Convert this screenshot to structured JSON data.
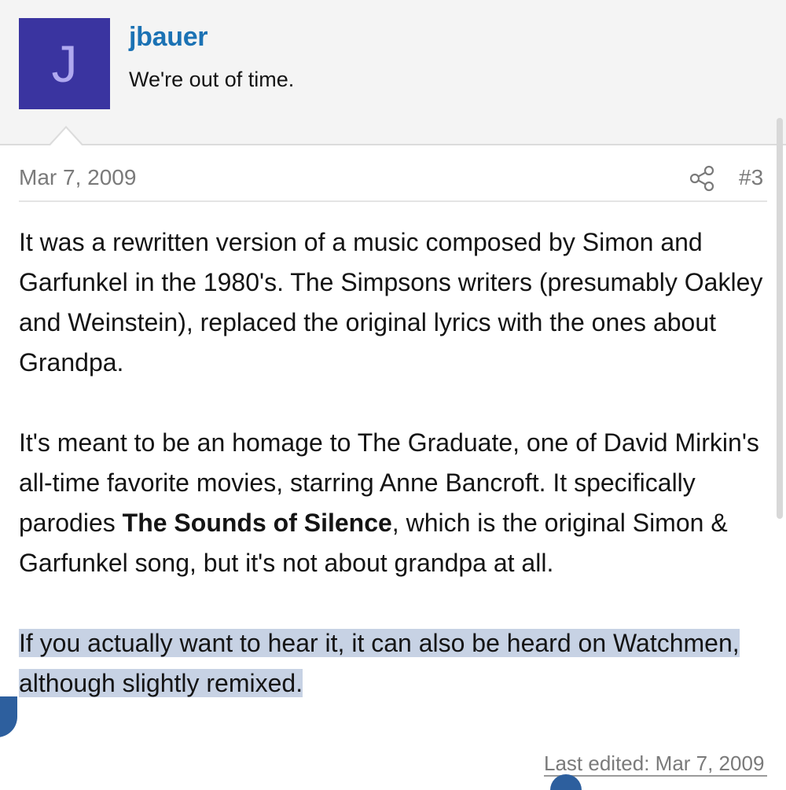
{
  "author": {
    "avatar_letter": "J",
    "name": "jbauer",
    "title": "We're out of time."
  },
  "post": {
    "date": "Mar 7, 2009",
    "number": "#3",
    "paragraph1": "It was a rewritten version of a music composed by Simon and Garfunkel in the 1980's. The Simpsons writers (presumably Oakley and Weinstein), replaced the original lyrics with the ones about Grandpa.",
    "paragraph2_before": "It's meant to be an homage to The Graduate, one of David Mirkin's all-time favorite movies, starring Anne Bancroft. It specifically parodies ",
    "paragraph2_bold": "The Sounds of Silence",
    "paragraph2_after": ", which is the original Simon & Garfunkel song, but it's not about grandpa at all.",
    "paragraph3": "If you actually want to hear it, it can also be heard on Watchmen, although slightly remixed.",
    "last_edited": "Last edited: Mar 7, 2009"
  },
  "icons": {
    "share": "share-icon"
  },
  "colors": {
    "avatar_bg": "#3a34a0",
    "username": "#1b72b4",
    "selection_highlight": "#c7d2e4",
    "selection_handle": "#2d5f9e"
  }
}
